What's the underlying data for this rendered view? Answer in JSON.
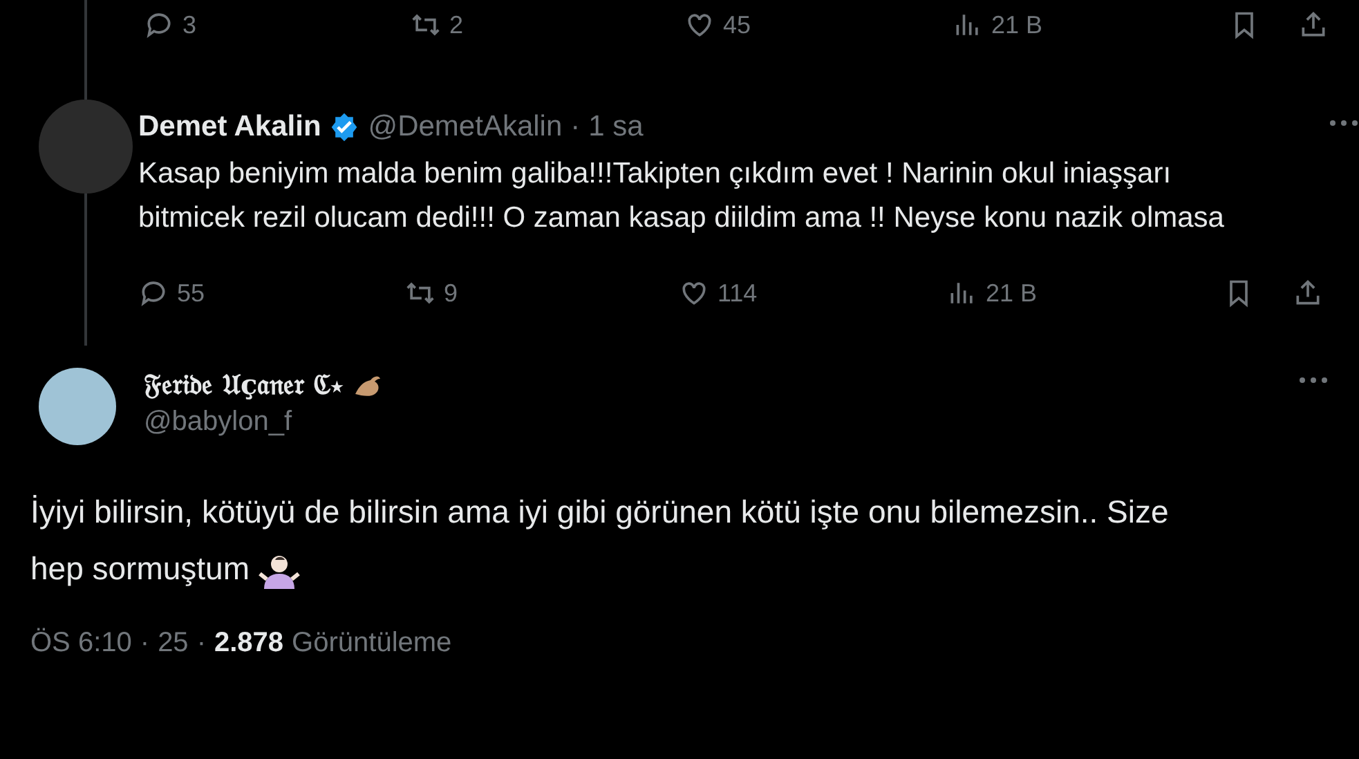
{
  "top_actions": {
    "replies": "3",
    "reposts": "2",
    "likes": "45",
    "views": "21 B"
  },
  "reply_tweet": {
    "name": "Demet Akalin",
    "verified": true,
    "handle": "@DemetAkalin",
    "separator": "·",
    "time": "1 sa",
    "text": "Kasap beniyim malda benim galiba!!!Takipten çıkdım evet ! Narinin okul iniaşşarı bitmicek rezil olucam dedi!!! O zaman kasap diildim ama !! Neyse konu nazik olmasa",
    "actions": {
      "replies": "55",
      "reposts": "9",
      "likes": "114",
      "views": "21 B"
    }
  },
  "main_tweet": {
    "name": "𝔉𝔢𝔯𝔦𝔡𝔢 𝔘ç𝔞𝔫𝔢𝔯 ℭ⋆",
    "handle": "@babylon_f",
    "text": "İyiyi bilirsin, kötüyü de bilirsin ama iyi gibi görünen kötü işte onu bilemezsin.. Size hep sormuştum",
    "time": "ÖS 6:10",
    "separator_1": "·",
    "date": "25",
    "separator_2": "·",
    "views": "2.878",
    "views_label": "Görüntüleme"
  }
}
